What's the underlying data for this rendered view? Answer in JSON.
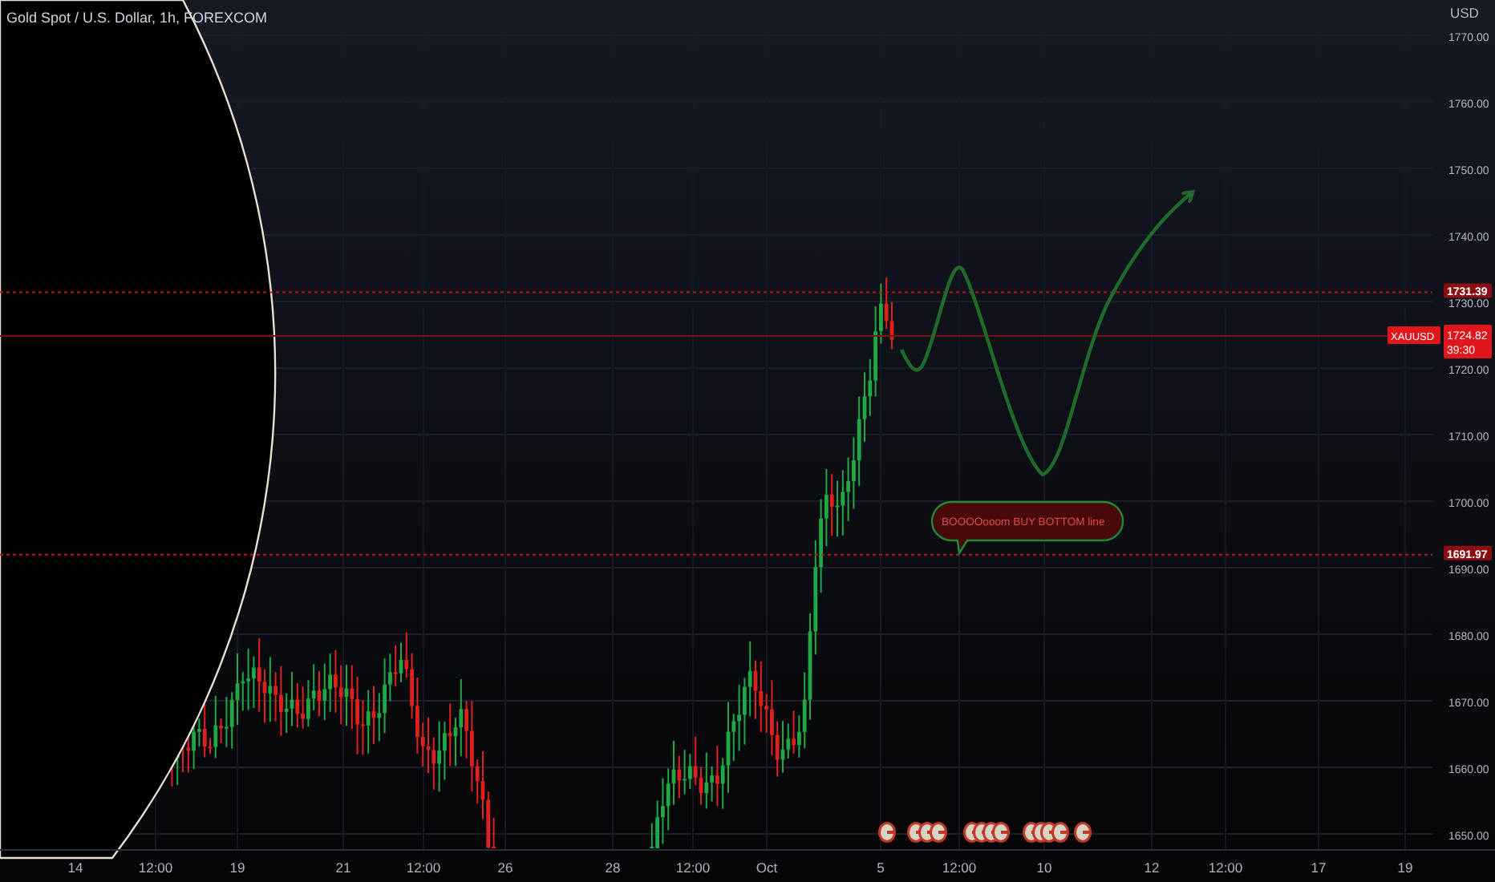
{
  "title": "Gold Spot / U.S. Dollar, 1h, FOREXCOM",
  "price_axis": {
    "currency": "USD",
    "ticks": [
      "1770.00",
      "1760.00",
      "1750.00",
      "1740.00",
      "1730.00",
      "1720.00",
      "1710.00",
      "1700.00",
      "1690.00",
      "1680.00",
      "1670.00",
      "1660.00",
      "1650.00"
    ]
  },
  "price_lines": [
    {
      "price": "1731.39"
    },
    {
      "price": "1691.97"
    }
  ],
  "last_price": {
    "symbol": "XAUUSD",
    "price": "1724.82",
    "countdown": "39:30"
  },
  "callout": {
    "text": "BOOOOooom BUY BOTTOM line"
  },
  "time_axis": [
    "14",
    "12:00",
    "19",
    "21",
    "12:00",
    "26",
    "28",
    "12:00",
    "Oct",
    "5",
    "12:00",
    "10",
    "12",
    "12:00",
    "17",
    "19"
  ]
}
